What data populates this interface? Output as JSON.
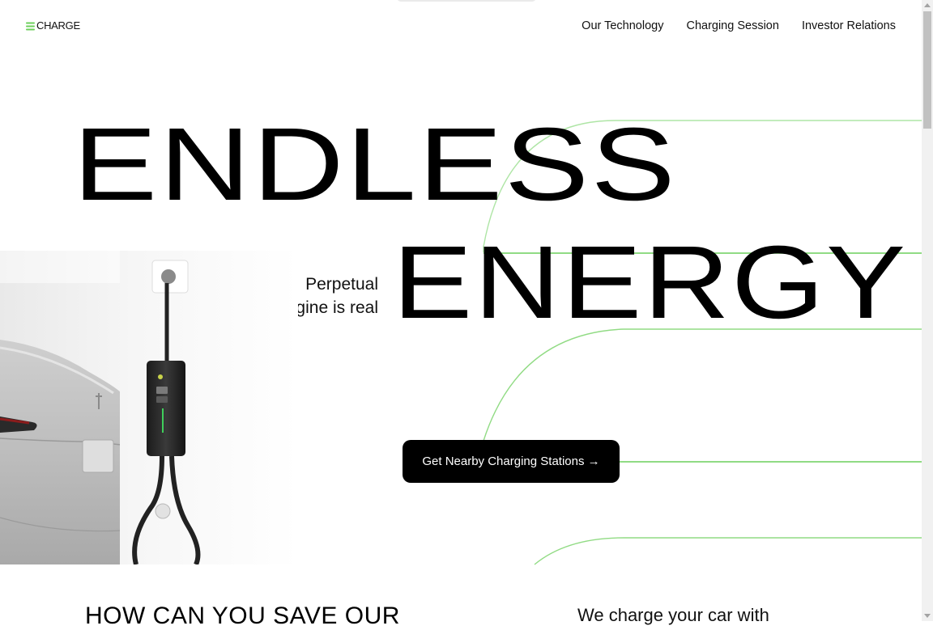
{
  "header": {
    "logo_text": "CHARGE",
    "nav": [
      {
        "label": "Our Technology"
      },
      {
        "label": "Charging Session"
      },
      {
        "label": "Investor Relations"
      }
    ]
  },
  "hero": {
    "word_1": "ENDLESS",
    "word_2": "ENERGY",
    "tagline_line_1": "Perpetual",
    "tagline_line_2": "engine is real",
    "cta_label": "Get Nearby Charging Stations →",
    "image_subject": "white electric car parked beside a wall-mounted EV charger"
  },
  "next_section": {
    "title": "HOW CAN YOU SAVE OUR",
    "intro": "We charge your car with"
  },
  "colors": {
    "accent": "#6ccf5b",
    "text": "#000000",
    "background": "#ffffff"
  }
}
